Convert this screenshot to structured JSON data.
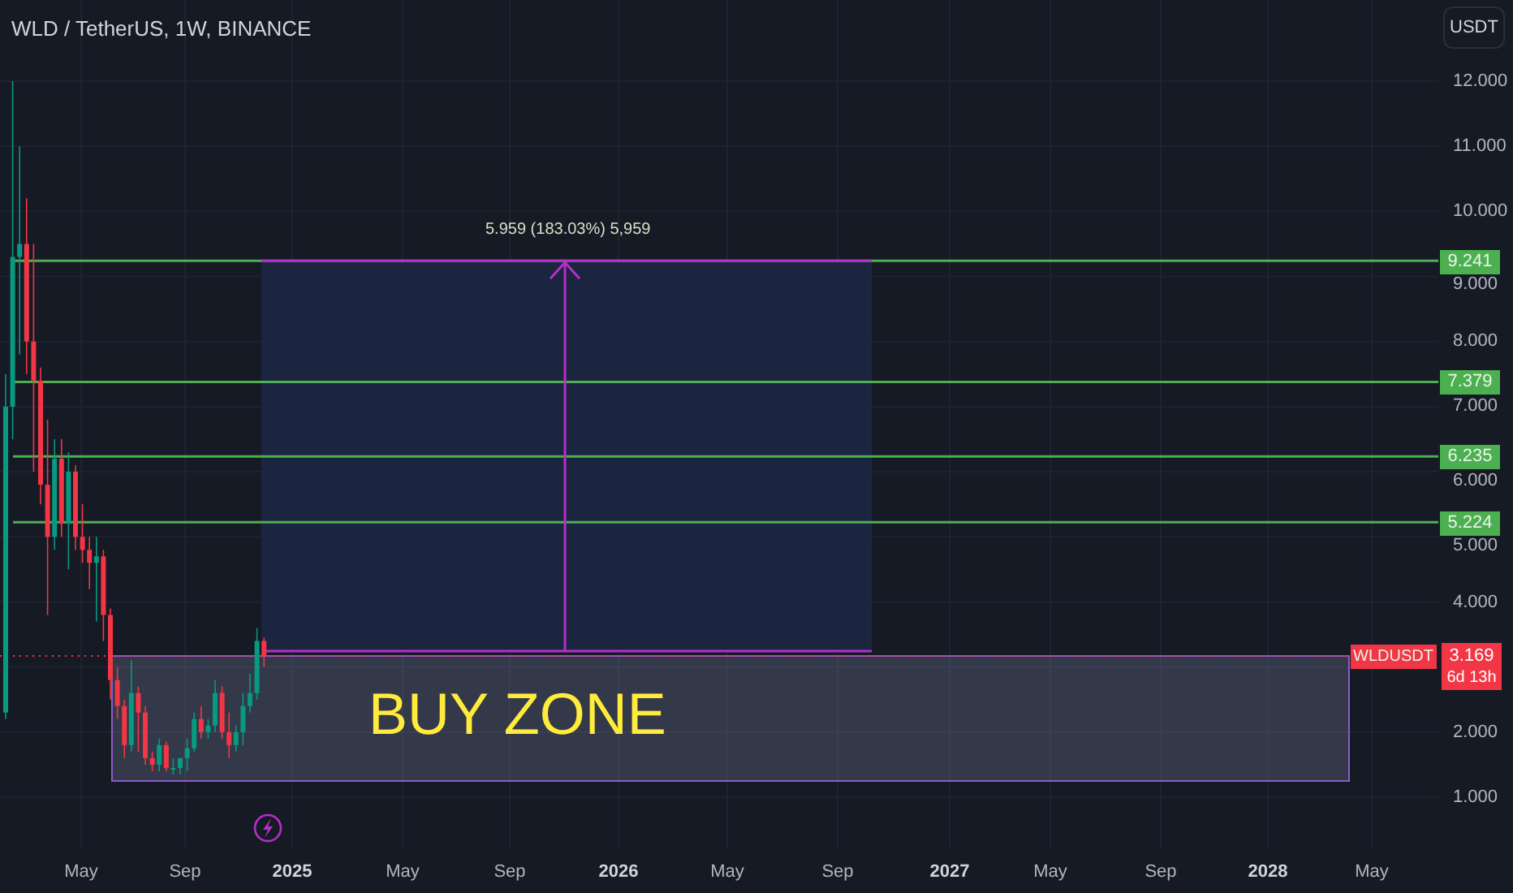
{
  "header": {
    "title": "WLD / TetherUS, 1W, BINANCE",
    "currency_button": "USDT"
  },
  "price_axis": [
    {
      "price": "12.000"
    },
    {
      "price": "11.000"
    },
    {
      "price": "10.000"
    },
    {
      "price": "9.000"
    },
    {
      "price": "8.000"
    },
    {
      "price": "7.000"
    },
    {
      "price": "6.000"
    },
    {
      "price": "5.000"
    },
    {
      "price": "4.000"
    },
    {
      "price": "2.000"
    },
    {
      "price": "1.000"
    }
  ],
  "time_axis": [
    {
      "label": "May",
      "kind": "month"
    },
    {
      "label": "Sep",
      "kind": "month"
    },
    {
      "label": "2025",
      "kind": "year"
    },
    {
      "label": "May",
      "kind": "month"
    },
    {
      "label": "Sep",
      "kind": "month"
    },
    {
      "label": "2026",
      "kind": "year"
    },
    {
      "label": "May",
      "kind": "month"
    },
    {
      "label": "Sep",
      "kind": "month"
    },
    {
      "label": "2027",
      "kind": "year"
    },
    {
      "label": "May",
      "kind": "month"
    },
    {
      "label": "Sep",
      "kind": "month"
    },
    {
      "label": "2028",
      "kind": "year"
    },
    {
      "label": "May",
      "kind": "month"
    }
  ],
  "levels": [
    {
      "price": "9.241"
    },
    {
      "price": "7.379"
    },
    {
      "price": "6.235"
    },
    {
      "price": "5.224"
    }
  ],
  "measurement": {
    "label": "5.959 (183.03%) 5,959"
  },
  "buy_zone": {
    "label": "BUY ZONE"
  },
  "current_price": {
    "symbol": "WLDUSDT",
    "price": "3.169",
    "countdown": "6d 13h"
  }
}
